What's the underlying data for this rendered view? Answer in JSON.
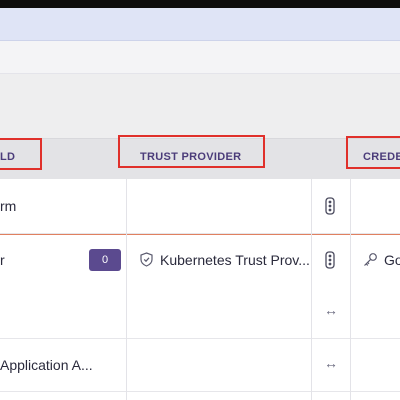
{
  "table": {
    "headers": {
      "col1": "LD",
      "trust_provider": "TRUST PROVIDER",
      "credentials": "CREDE"
    },
    "rows": [
      {
        "name": "rm"
      },
      {
        "name": "r",
        "badge": "0",
        "trust_provider": "Kubernetes Trust Prov...",
        "credential": "Go"
      },
      {
        "name": ""
      },
      {
        "name": "Application A..."
      }
    ],
    "arrow_glyph": "↔"
  },
  "colors": {
    "highlight_box": "#e0302b",
    "badge_bg": "#5b4a8f",
    "header_text": "#4b3c7a",
    "selected_row_border": "#e08060"
  }
}
